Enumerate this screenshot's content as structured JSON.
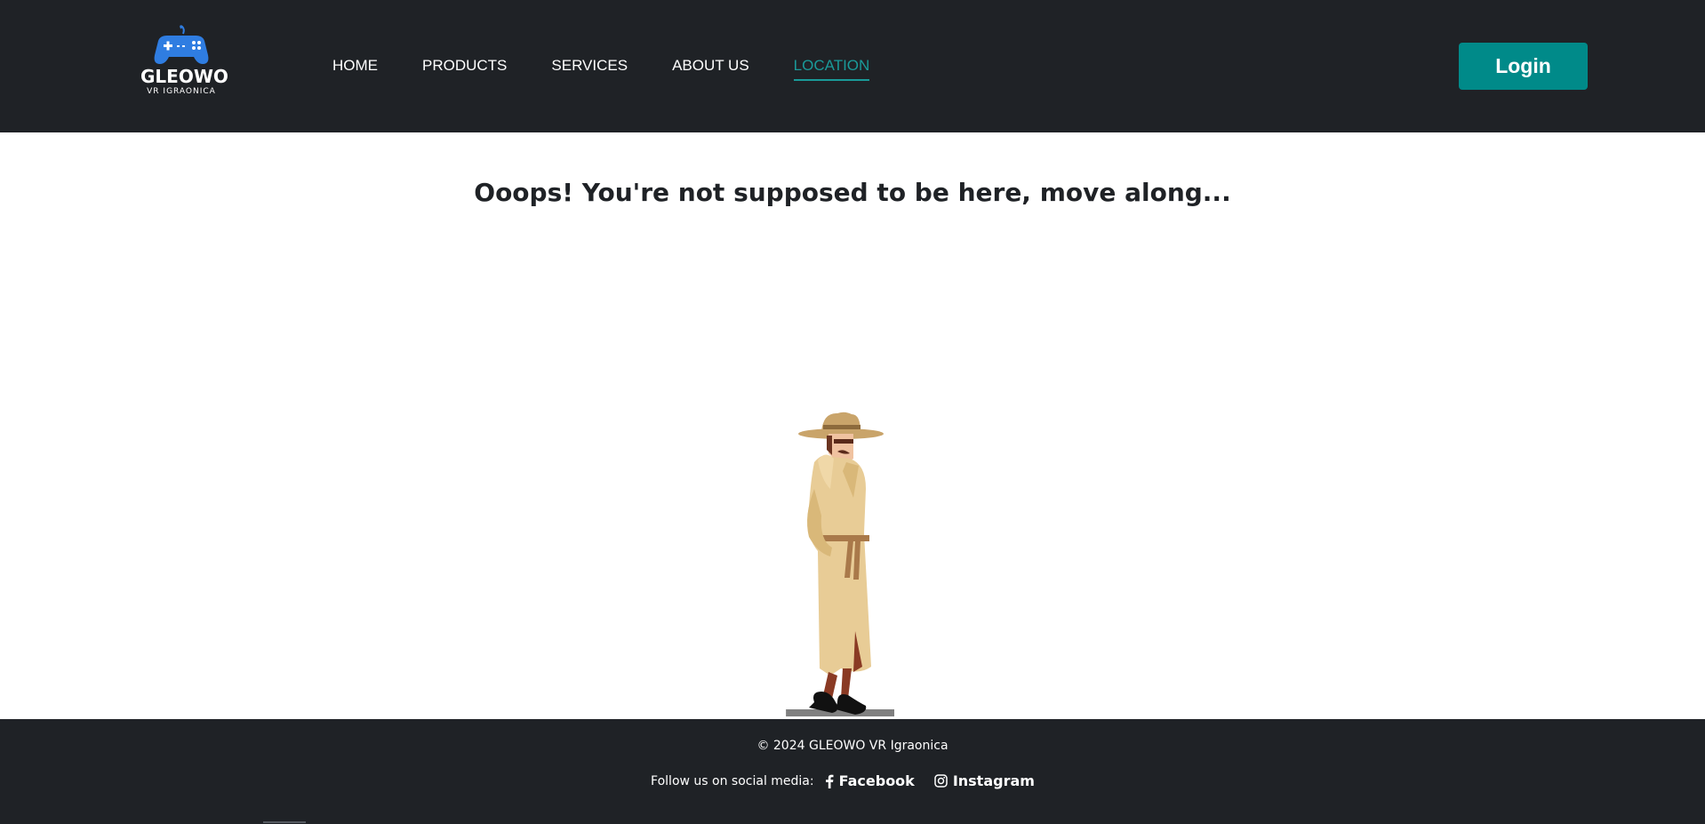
{
  "logo": {
    "name": "GLEOWO",
    "subtitle": "VR IGRAONICA",
    "icon": "gamepad-icon",
    "color": "#2f7de1"
  },
  "nav": {
    "items": [
      {
        "label": "HOME",
        "active": false
      },
      {
        "label": "PRODUCTS",
        "active": false
      },
      {
        "label": "SERVICES",
        "active": false
      },
      {
        "label": "ABOUT US",
        "active": false
      },
      {
        "label": "LOCATION",
        "active": true
      }
    ]
  },
  "header": {
    "login_label": "Login",
    "accent": "#008a89"
  },
  "main": {
    "message": "Ooops! You're not supposed to be here, move along..."
  },
  "footer": {
    "copyright": "© 2024 GLEOWO VR Igraonica",
    "follow_text": "Follow us on social media:",
    "facebook_label": "Facebook",
    "instagram_label": "Instagram"
  }
}
